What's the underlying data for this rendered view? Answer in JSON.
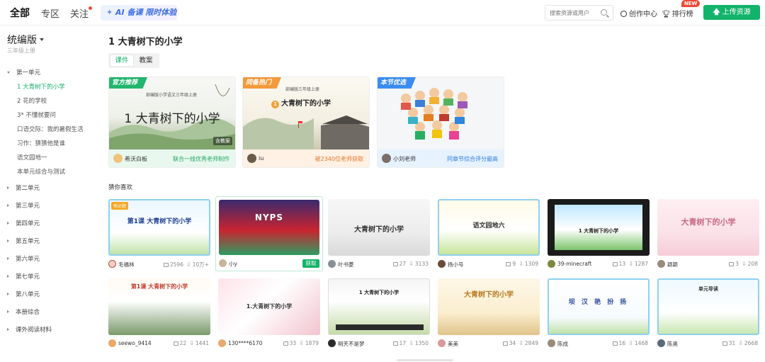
{
  "nav": {
    "tabs": [
      "全部",
      "专区",
      "关注"
    ],
    "ai_button": "AI 备课 限时体验 →",
    "search_placeholder": "搜索资源或用户",
    "creator_center": "创作中心",
    "leaderboard": "排行榜",
    "new_badge": "NEW",
    "upload": "上传资源"
  },
  "sidebar": {
    "edition": "统编版",
    "grade": "三年级上册",
    "first_unit": "第一单元",
    "lessons": [
      "1 大青树下的小学",
      "2 花的学校",
      "3* 不懂就要问",
      "口语交际：我的暑假生活",
      "习作：猜猜他是谁",
      "语文园地一",
      "本单元综合与测试"
    ],
    "other_units": [
      "第二单元",
      "第三单元",
      "第四单元",
      "第五单元",
      "第六单元",
      "第七单元",
      "第八单元",
      "本册综合",
      "课外阅读材料"
    ]
  },
  "main": {
    "title": "1 大青树下的小学",
    "tabs": [
      "课件",
      "教案"
    ],
    "guess_label": "猜你喜欢"
  },
  "featured": [
    {
      "ribbon": "官方推荐",
      "author": "希沃白板",
      "slogan": "联合一线优秀老师制作",
      "pub": "部编版小学语文三年级上册",
      "title": "1 大青树下的小学",
      "tag": "含教案",
      "ribbon_color": "#22b66e",
      "foot_bg": "#e9f8ef",
      "slogan_color": "#22a765"
    },
    {
      "ribbon": "同备热门",
      "author": "iu",
      "slogan": "被2340位老师获取",
      "pub": "部编版三年级上册",
      "title": "大青树下的小学",
      "num": "1",
      "ribbon_color": "#f39a3b",
      "foot_bg": "#fff1e4",
      "slogan_color": "#e3782a"
    },
    {
      "ribbon": "本节优选",
      "author": "小刘老师",
      "slogan": "同章节综合评分最高",
      "ribbon_color": "#3b8cf0",
      "foot_bg": "#e7f2ff",
      "slogan_color": "#2f7de0"
    }
  ],
  "cards": [
    {
      "author": "毛福林",
      "likes": "2596",
      "downloads": "10万+",
      "slide": "第1课 大青树下的小学",
      "tag": "帮必题"
    },
    {
      "author": "小y",
      "get": "获取",
      "slide": "NYPS"
    },
    {
      "author": "叶书菱",
      "likes": "27",
      "downloads": "3133",
      "slide": "大青树下的小学"
    },
    {
      "author": "扬小号",
      "likes": "9",
      "downloads": "1309",
      "slide": "语文园地六"
    },
    {
      "author": "39-minecraft",
      "likes": "13",
      "downloads": "1287",
      "slide": "1 大青树下的小学"
    },
    {
      "author": "颖颖",
      "likes": "3",
      "downloads": "208",
      "slide": "大青树下的小学"
    },
    {
      "author": "seewo_9414",
      "likes": "22",
      "downloads": "1441",
      "slide": "第1课 大青树下的小学"
    },
    {
      "author": "130****6170",
      "likes": "33",
      "downloads": "1879",
      "slide": "1.大青树下的小学"
    },
    {
      "author": "明天不是梦",
      "likes": "17",
      "downloads": "1350",
      "slide": "1 大青树下的小学"
    },
    {
      "author": "美美",
      "likes": "34",
      "downloads": "2849",
      "slide": "大青树下的小学"
    },
    {
      "author": "陈成",
      "likes": "16",
      "downloads": "1468",
      "slide": "坝 汉 艳 扮 扬"
    },
    {
      "author": "陈奥",
      "likes": "31",
      "downloads": "2668",
      "slide": "单元导读"
    }
  ]
}
